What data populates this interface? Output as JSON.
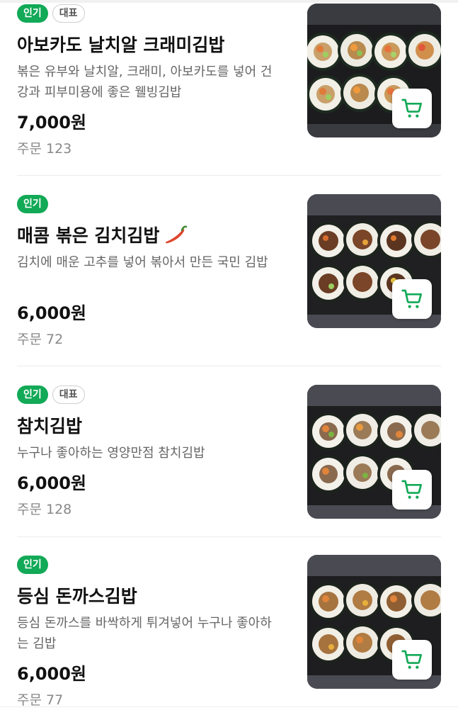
{
  "colors": {
    "accent": "#12a957",
    "price": "#111111",
    "muted": "#888888"
  },
  "items": [
    {
      "badges": [
        "인기",
        "대표"
      ],
      "name": "아보카도 날치알 크래미김밥",
      "has_chili": false,
      "description": "볶은 유부와 날치알, 크래미, 아보카도를 넣어 건강과 피부미용에 좋은 웰빙김밥",
      "price": "7,000원",
      "orders": "주문 123",
      "image_icon": "avocado-kimbap-photo",
      "cart_icon": "cart-icon"
    },
    {
      "badges": [
        "인기"
      ],
      "name": "매콤 볶은 김치김밥",
      "has_chili": true,
      "description": "김치에 매운 고추를 넣어 볶아서 만든 국민 김밥",
      "price": "6,000원",
      "orders": "주문 72",
      "image_icon": "kimchi-kimbap-photo",
      "cart_icon": "cart-icon"
    },
    {
      "badges": [
        "인기",
        "대표"
      ],
      "name": "참치김밥",
      "has_chili": false,
      "description": "누구나 좋아하는 영양만점 참치김밥",
      "price": "6,000원",
      "orders": "주문 128",
      "image_icon": "tuna-kimbap-photo",
      "cart_icon": "cart-icon"
    },
    {
      "badges": [
        "인기"
      ],
      "name": "등심 돈까스김밥",
      "has_chili": false,
      "description": "등심 돈까스를 바싹하게 튀겨넣어 누구나 좋아하는 김밥",
      "price": "6,000원",
      "orders": "주문 77",
      "image_icon": "pork-cutlet-kimbap-photo",
      "cart_icon": "cart-icon"
    }
  ]
}
